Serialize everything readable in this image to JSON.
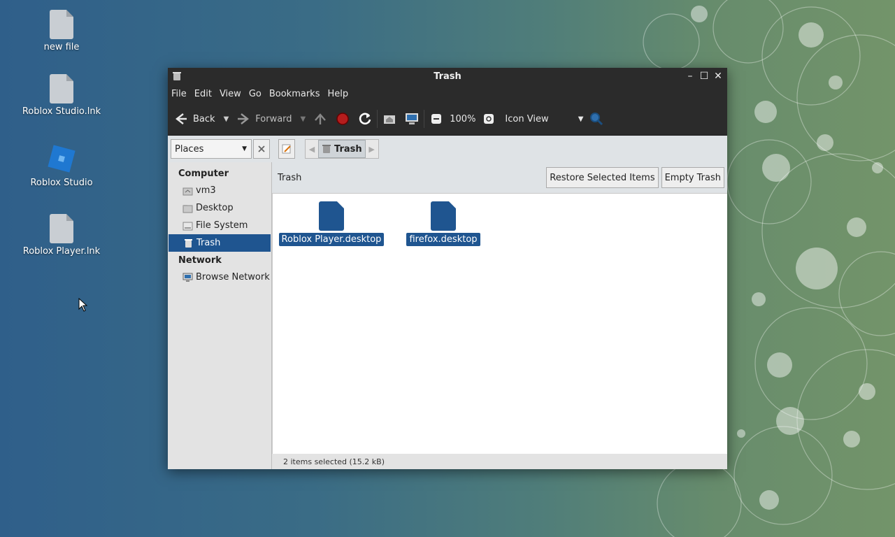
{
  "desktop": {
    "icons": [
      {
        "label": "new file",
        "icon": "document-icon"
      },
      {
        "label": "Roblox Studio.lnk",
        "icon": "document-icon"
      },
      {
        "label": "Roblox Studio",
        "icon": "roblox-studio-icon"
      },
      {
        "label": "Roblox Player.lnk",
        "icon": "document-icon"
      }
    ]
  },
  "window": {
    "title": "Trash",
    "menu": [
      "File",
      "Edit",
      "View",
      "Go",
      "Bookmarks",
      "Help"
    ],
    "toolbar": {
      "back": "Back",
      "forward": "Forward",
      "zoom": "100%",
      "view_mode": "Icon View"
    },
    "location": {
      "places": "Places",
      "crumb": "Trash"
    },
    "sidebar": {
      "sections": [
        {
          "heading": "Computer",
          "items": [
            "vm3",
            "Desktop",
            "File System",
            "Trash"
          ]
        },
        {
          "heading": "Network",
          "items": [
            "Browse Network"
          ]
        }
      ],
      "active": "Trash"
    },
    "content": {
      "heading": "Trash",
      "restore_label": "Restore Selected Items",
      "empty_label": "Empty Trash",
      "files": [
        "Roblox Player.desktop",
        "firefox.desktop"
      ]
    },
    "status": "2 items selected (15.2 kB)"
  },
  "colors": {
    "selection": "#1f5590",
    "toolbar_bg": "#2b2b2b"
  }
}
